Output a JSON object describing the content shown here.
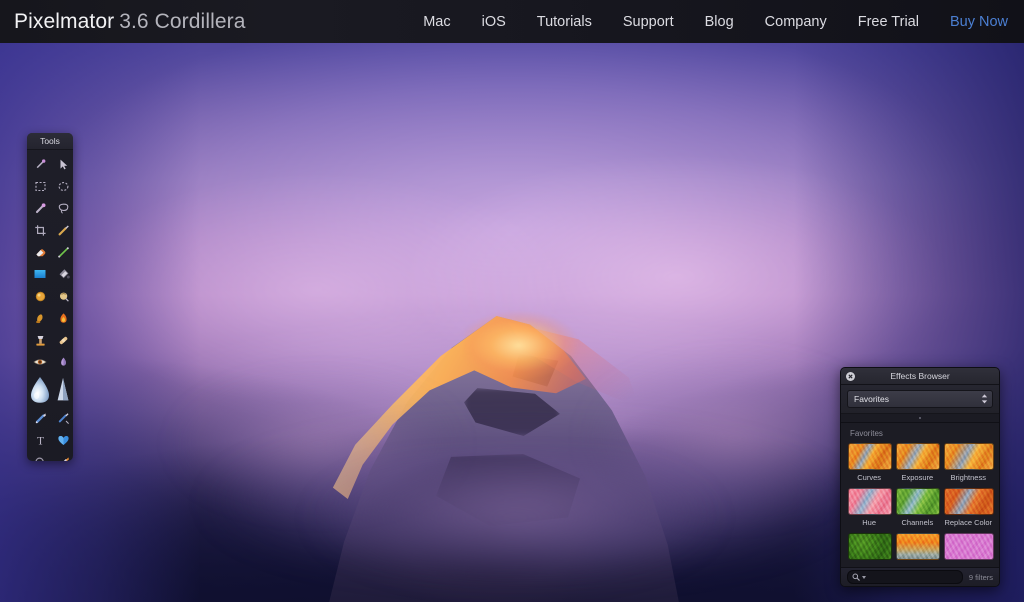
{
  "header": {
    "brand_name": "Pixelmator",
    "brand_version": "3.6 Cordillera",
    "nav": [
      {
        "label": "Mac",
        "icon": "nav-link",
        "accent": false
      },
      {
        "label": "iOS",
        "icon": "nav-link",
        "accent": false
      },
      {
        "label": "Tutorials",
        "icon": "nav-link",
        "accent": false
      },
      {
        "label": "Support",
        "icon": "nav-link",
        "accent": false
      },
      {
        "label": "Blog",
        "icon": "nav-link",
        "accent": false
      },
      {
        "label": "Company",
        "icon": "nav-link",
        "accent": false
      },
      {
        "label": "Free Trial",
        "icon": "nav-link",
        "accent": false
      },
      {
        "label": "Buy Now",
        "icon": "nav-link",
        "accent": true
      }
    ],
    "accent_color": "#4b7fd2",
    "background_color": "#16161e"
  },
  "tools_palette": {
    "title": "Tools",
    "tools": [
      {
        "name": "magic-wand-tool",
        "icon": "magic-wand-icon"
      },
      {
        "name": "move-tool",
        "icon": "arrow-cursor-icon"
      },
      {
        "name": "rectangular-select",
        "icon": "rectangle-marquee-icon"
      },
      {
        "name": "elliptical-select",
        "icon": "ellipse-marquee-icon"
      },
      {
        "name": "paint-selection-tool",
        "icon": "selection-brush-icon"
      },
      {
        "name": "free-select-tool",
        "icon": "lasso-icon"
      },
      {
        "name": "crop-tool",
        "icon": "crop-icon"
      },
      {
        "name": "color-picker-tool",
        "icon": "eyedropper-icon"
      },
      {
        "name": "eraser-tool",
        "icon": "eraser-icon"
      },
      {
        "name": "line-tool",
        "icon": "line-icon"
      },
      {
        "name": "gradient-fill-tool",
        "icon": "gradient-fill-icon"
      },
      {
        "name": "paint-bucket-tool",
        "icon": "paint-bucket-icon"
      },
      {
        "name": "dodge-tool",
        "icon": "dodge-icon"
      },
      {
        "name": "smudge-tool",
        "icon": "smudge-finger-icon"
      },
      {
        "name": "sponge-tool",
        "icon": "sponge-icon"
      },
      {
        "name": "burn-tool",
        "icon": "flame-icon"
      },
      {
        "name": "clone-stamp-tool",
        "icon": "clone-stamp-icon"
      },
      {
        "name": "healing-tool",
        "icon": "bandage-icon"
      },
      {
        "name": "red-eye-tool",
        "icon": "eye-icon"
      },
      {
        "name": "light-wand-tool",
        "icon": "light-wand-icon"
      },
      {
        "name": "blur-tool",
        "icon": "water-drop-icon"
      },
      {
        "name": "sharpen-tool",
        "icon": "sharpen-cone-icon"
      },
      {
        "name": "pen-tool",
        "icon": "pen-icon"
      },
      {
        "name": "pencil-tool",
        "icon": "pencil-icon"
      },
      {
        "name": "type-tool",
        "icon": "text-t-icon"
      },
      {
        "name": "shape-tool",
        "icon": "heart-shape-icon"
      },
      {
        "name": "zoom-tool",
        "icon": "magnifier-icon"
      },
      {
        "name": "paint-brush-tool",
        "icon": "paintbrush-icon"
      }
    ]
  },
  "effects_browser": {
    "window_title": "Effects Browser",
    "close_icon": "close-x-icon",
    "category_label": "Favorites",
    "stepper_icon": "up-down-chevron-icon",
    "section_title": "Favorites",
    "items": [
      {
        "label": "Curves",
        "thumb": "th-curves"
      },
      {
        "label": "Exposure",
        "thumb": "th-exposure"
      },
      {
        "label": "Brightness",
        "thumb": "th-brightness"
      },
      {
        "label": "Hue",
        "thumb": "th-hue"
      },
      {
        "label": "Channels",
        "thumb": "th-channels"
      },
      {
        "label": "Replace Color",
        "thumb": "th-replace"
      },
      {
        "label": "",
        "thumb": "th-green"
      },
      {
        "label": "",
        "thumb": "th-sunset"
      },
      {
        "label": "",
        "thumb": "th-pink"
      }
    ],
    "search_placeholder": "",
    "search_icon": "search-magnifier-icon",
    "filter_count": "9 filters"
  },
  "wallpaper": {
    "subject": "mountain-peak-at-sunrise",
    "colors": {
      "sky_top_left": "#3b3590",
      "sky_top_right": "#2a2878",
      "mist_mauve": "#a87ab8",
      "bottom_navy": "#191a40",
      "peak_gold": "#ffb84a"
    }
  }
}
